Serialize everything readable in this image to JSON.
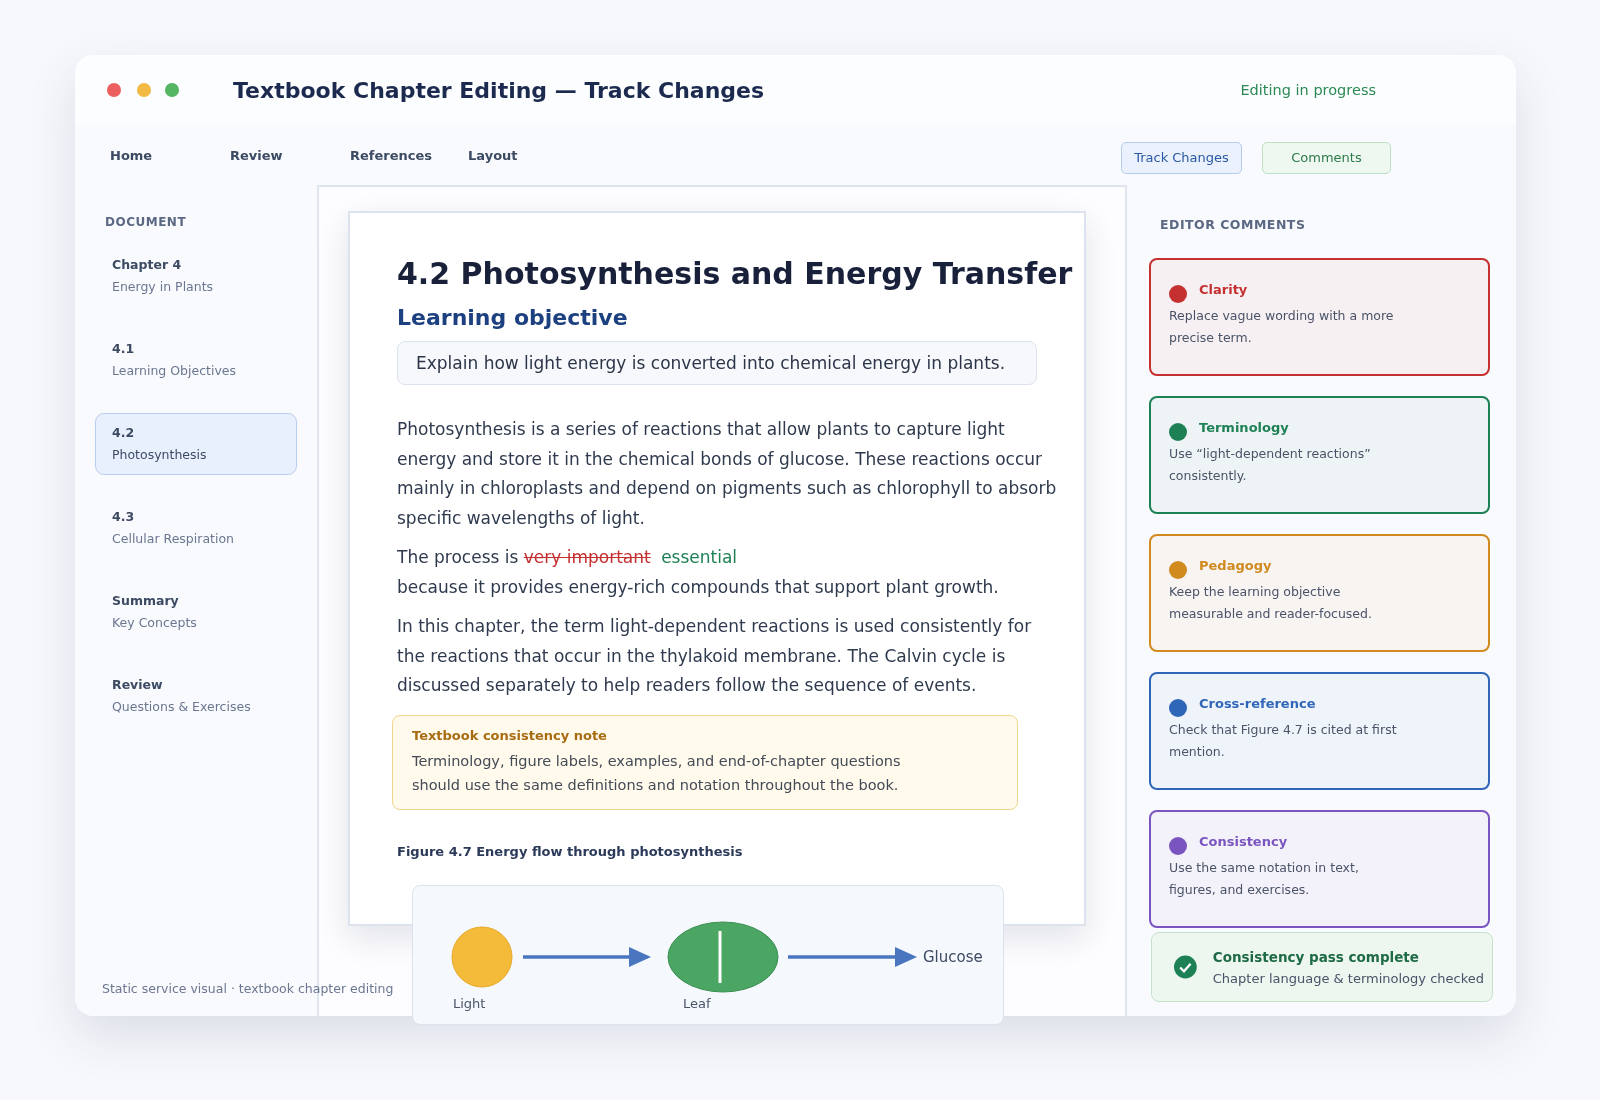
{
  "window": {
    "title": "Textbook Chapter Editing — Track Changes",
    "status": "Editing in progress"
  },
  "toolbar": {
    "tabs": [
      "Home",
      "Review",
      "References",
      "Layout"
    ],
    "buttons": [
      {
        "label": "Track Changes",
        "kind": "track"
      },
      {
        "label": "Comments",
        "kind": "comments"
      }
    ]
  },
  "sidebar": {
    "heading": "DOCUMENT",
    "items": [
      {
        "title": "Chapter 4",
        "subtitle": "Energy in Plants",
        "selected": false
      },
      {
        "title": "4.1",
        "subtitle": "Learning Objectives",
        "selected": false
      },
      {
        "title": "4.2",
        "subtitle": "Photosynthesis",
        "selected": true
      },
      {
        "title": "4.3",
        "subtitle": "Cellular Respiration",
        "selected": false
      },
      {
        "title": "Summary",
        "subtitle": "Key Concepts",
        "selected": false
      },
      {
        "title": "Review",
        "subtitle": "Questions & Exercises",
        "selected": false
      }
    ],
    "footer": "Static service visual · textbook chapter editing"
  },
  "document": {
    "title": "4.2 Photosynthesis and Energy Transfer",
    "objective_heading": "Learning objective",
    "objective": "Explain how light energy is converted into chemical energy in plants.",
    "paragraphs": [
      {
        "kind": "plain",
        "text": "Photosynthesis is a series of reactions that allow plants to capture light energy and store it in the chemical bonds of glucose. These reactions occur mainly in chloroplasts and depend on pigments such as chlorophyll to absorb specific wavelengths of light."
      },
      {
        "kind": "change",
        "before": "The process is",
        "deleted": "very important",
        "inserted": "essential",
        "after": "because it provides energy-rich compounds that support plant growth."
      },
      {
        "kind": "plain",
        "text": "In this chapter, the term light-dependent reactions is used consistently for the reactions that occur in the thylakoid membrane. The Calvin cycle is discussed separately to help readers follow the sequence of events."
      }
    ],
    "note": {
      "title": "Textbook consistency note",
      "text": "Terminology, figure labels, examples, and end-of-chapter questions should use the same definitions and notation throughout the book."
    },
    "figure": {
      "caption": "Figure 4.7  Energy flow through photosynthesis",
      "labels": [
        "Light",
        "Leaf",
        "Glucose"
      ]
    }
  },
  "comments": {
    "heading": "EDITOR COMMENTS",
    "items": [
      {
        "title": "Clarity",
        "text": "Replace vague wording with a more precise term.",
        "color": "#c53030"
      },
      {
        "title": "Terminology",
        "text": "Use “light-dependent reactions” consistently.",
        "color": "#1e8155"
      },
      {
        "title": "Pedagogy",
        "text": "Keep the learning objective measurable and reader-focused.",
        "color": "#d08a1e"
      },
      {
        "title": "Cross-reference",
        "text": "Check that Figure 4.7 is cited at first mention.",
        "color": "#2f66b8"
      },
      {
        "title": "Consistency",
        "text": "Use the same notation in text, figures, and exercises.",
        "color": "#7a55c0"
      }
    ]
  },
  "toast": {
    "title": "Consistency pass complete",
    "text": "Chapter language & terminology checked"
  }
}
